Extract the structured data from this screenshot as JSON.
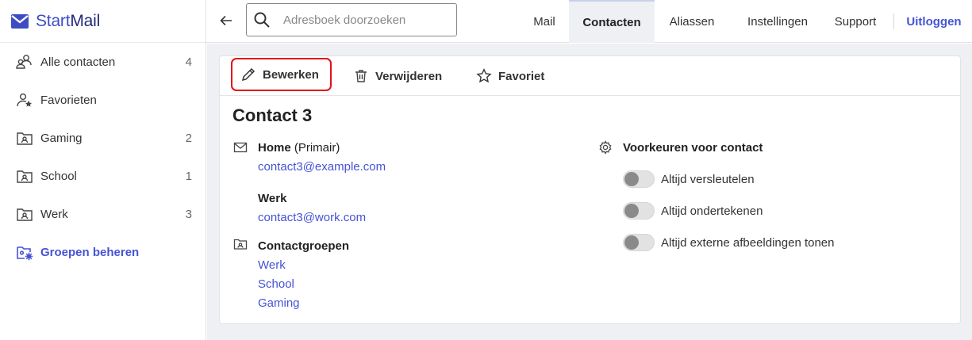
{
  "brand": {
    "name_part1": "Start",
    "name_part2": "Mail"
  },
  "sidebar": {
    "items": [
      {
        "label": "Alle contacten",
        "count": "4",
        "icon": "contacts-icon"
      },
      {
        "label": "Favorieten",
        "count": "",
        "icon": "favorite-person-icon"
      },
      {
        "label": "Gaming",
        "count": "2",
        "icon": "group-folder-icon"
      },
      {
        "label": "School",
        "count": "1",
        "icon": "group-folder-icon"
      },
      {
        "label": "Werk",
        "count": "3",
        "icon": "group-folder-icon"
      }
    ],
    "manage_label": "Groepen beheren"
  },
  "topbar": {
    "search_placeholder": "Adresboek doorzoeken",
    "nav": [
      {
        "label": "Mail",
        "active": false
      },
      {
        "label": "Contacten",
        "active": true
      },
      {
        "label": "Aliassen",
        "active": false
      },
      {
        "label": "Instellingen",
        "active": false
      },
      {
        "label": "Support",
        "active": false
      }
    ],
    "logout_label": "Uitloggen"
  },
  "toolbar": {
    "edit_label": "Bewerken",
    "delete_label": "Verwijderen",
    "favorite_label": "Favoriet"
  },
  "contact": {
    "name": "Contact 3",
    "emails": [
      {
        "type": "Home",
        "note": "(Primair)",
        "address": "contact3@example.com"
      },
      {
        "type": "Werk",
        "note": "",
        "address": "contact3@work.com"
      }
    ],
    "groups_title": "Contactgroepen",
    "groups": [
      "Werk",
      "School",
      "Gaming"
    ]
  },
  "preferences": {
    "title": "Voorkeuren voor contact",
    "toggles": [
      {
        "label": "Altijd versleutelen",
        "on": false
      },
      {
        "label": "Altijd ondertekenen",
        "on": false
      },
      {
        "label": "Altijd externe afbeeldingen tonen",
        "on": false
      }
    ]
  },
  "colors": {
    "accent": "#4553d6",
    "brand_dark": "#232a7a",
    "highlight": "#e4101a",
    "background": "#eef0f3"
  }
}
